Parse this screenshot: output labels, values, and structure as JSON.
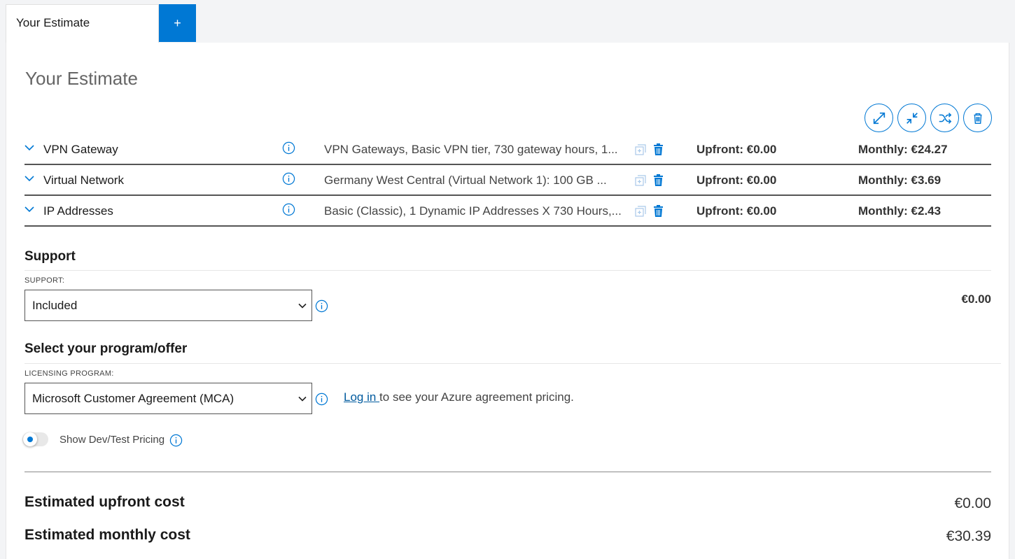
{
  "tabs": {
    "active_label": "Your Estimate",
    "add_label": "+"
  },
  "page": {
    "title": "Your Estimate"
  },
  "toolbar": {
    "icons": [
      "expand-all-icon",
      "collapse-all-icon",
      "shuffle-icon",
      "delete-all-icon"
    ]
  },
  "items": [
    {
      "name": "VPN Gateway",
      "description": "VPN Gateways, Basic VPN tier, 730 gateway hours, 1...",
      "upfront": "Upfront: €0.00",
      "monthly": "Monthly: €24.27"
    },
    {
      "name": "Virtual Network",
      "description": "Germany West Central (Virtual Network 1): 100 GB ...",
      "upfront": "Upfront: €0.00",
      "monthly": "Monthly: €3.69"
    },
    {
      "name": "IP Addresses",
      "description": "Basic (Classic), 1 Dynamic IP Addresses X 730 Hours,...",
      "upfront": "Upfront: €0.00",
      "monthly": "Monthly: €2.43"
    }
  ],
  "support": {
    "heading": "Support",
    "label": "SUPPORT:",
    "selected": "Included",
    "price": "€0.00"
  },
  "program": {
    "heading": "Select your program/offer",
    "label": "LICENSING PROGRAM:",
    "selected": "Microsoft Customer Agreement (MCA)",
    "login_link": "Log in ",
    "login_text": "to see your Azure agreement pricing."
  },
  "devtest": {
    "label": "Show Dev/Test Pricing",
    "enabled": true
  },
  "totals": {
    "upfront_label": "Estimated upfront cost",
    "upfront_value": "€0.00",
    "monthly_label": "Estimated monthly cost",
    "monthly_value": "€30.39"
  },
  "colors": {
    "accent": "#0078d4",
    "link": "#005a9e"
  }
}
